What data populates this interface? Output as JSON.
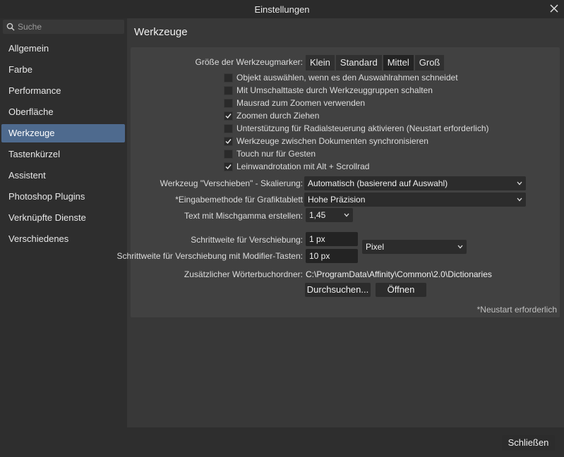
{
  "window": {
    "title": "Einstellungen",
    "close_icon": "close-icon"
  },
  "sidebar": {
    "search_placeholder": "Suche",
    "items": [
      {
        "label": "Allgemein",
        "active": false
      },
      {
        "label": "Farbe",
        "active": false
      },
      {
        "label": "Performance",
        "active": false
      },
      {
        "label": "Oberfläche",
        "active": false
      },
      {
        "label": "Werkzeuge",
        "active": true
      },
      {
        "label": "Tastenkürzel",
        "active": false
      },
      {
        "label": "Assistent",
        "active": false
      },
      {
        "label": "Photoshop Plugins",
        "active": false
      },
      {
        "label": "Verknüpfte Dienste",
        "active": false
      },
      {
        "label": "Verschiedenes",
        "active": false
      }
    ]
  },
  "main": {
    "title": "Werkzeuge",
    "marker_size": {
      "label": "Größe der Werkzeugmarker:",
      "options": [
        "Klein",
        "Standard",
        "Mittel",
        "Groß"
      ],
      "selected": "Mittel"
    },
    "checkboxes": [
      {
        "label": "Objekt auswählen, wenn es den Auswahlrahmen schneidet",
        "checked": false
      },
      {
        "label": "Mit Umschalttaste durch Werkzeuggruppen schalten",
        "checked": false
      },
      {
        "label": "Mausrad zum Zoomen verwenden",
        "checked": false
      },
      {
        "label": "Zoomen durch Ziehen",
        "checked": true
      },
      {
        "label": "Unterstützung für Radialsteuerung aktivieren (Neustart erforderlich)",
        "checked": false
      },
      {
        "label": "Werkzeuge zwischen Dokumenten synchronisieren",
        "checked": true
      },
      {
        "label": "Touch nur für Gesten",
        "checked": false
      },
      {
        "label": "Leinwandrotation mit Alt + Scrollrad",
        "checked": true
      }
    ],
    "move_scaling": {
      "label": "Werkzeug \"Verschieben\" - Skalierung:",
      "value": "Automatisch (basierend auf Auswahl)"
    },
    "tablet_input": {
      "label": "*Eingabemethode für Grafiktablett",
      "value": "Hohe Präzision"
    },
    "gamma": {
      "label": "Text mit Mischgamma erstellen:",
      "value": "1,45"
    },
    "nudge": {
      "label": "Schrittweite für Verschiebung:",
      "value": "1 px"
    },
    "nudge_modifier": {
      "label": "Schrittweite für Verschiebung mit Modifier-Tasten:",
      "value": "10 px"
    },
    "nudge_unit": {
      "value": "Pixel"
    },
    "dictionary": {
      "label": "Zusätzlicher Wörterbuchordner:",
      "path": "C:\\ProgramData\\Affinity\\Common\\2.0\\Dictionaries",
      "browse_label": "Durchsuchen...",
      "open_label": "Öffnen"
    },
    "restart_note": "*Neustart erforderlich"
  },
  "footer": {
    "close_label": "Schließen"
  },
  "colors": {
    "accent": "#4e6a8e",
    "window_bg": "#2e2e2e",
    "panel_bg": "#414141"
  }
}
